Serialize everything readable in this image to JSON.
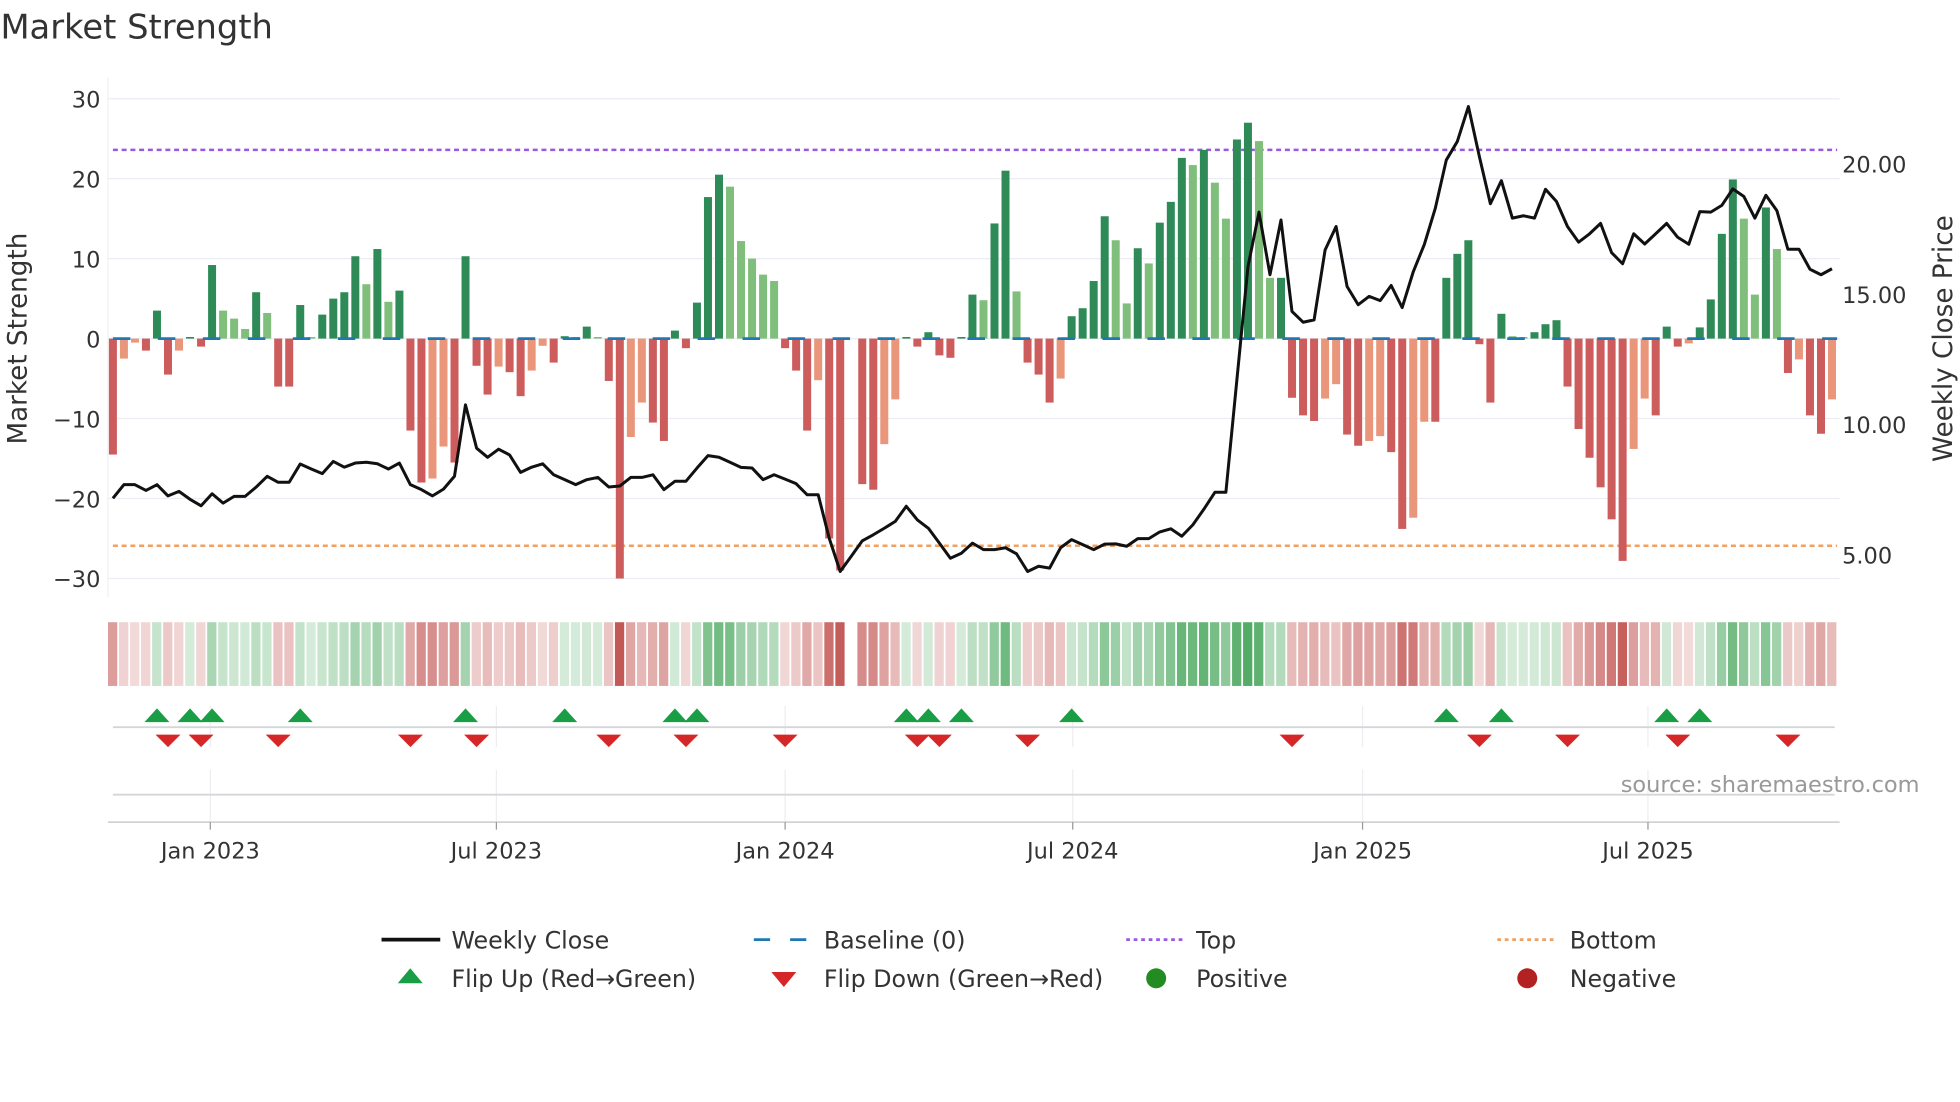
{
  "title": "Market Strength",
  "source": "source: sharemaestro.com",
  "colors": {
    "bar_pos_rising": "#2e8b57",
    "bar_pos_falling": "#7fbf7b",
    "bar_neg_falling": "#cd5c5c",
    "bar_neg_rising": "#e9967a",
    "close_line": "#111111",
    "baseline": "#1f77b4",
    "top": "#9b59e0",
    "bottom": "#f0a060",
    "flip_up": "#1a9e45",
    "flip_down": "#d62728",
    "positive": "#228b22",
    "negative": "#b22222",
    "strip_pos": "#3aa050",
    "strip_neg": "#c0504d"
  },
  "chart_data": {
    "type": "bar",
    "title": "Market Strength",
    "ylabel": "Market Strength",
    "y2label": "Weekly Close Price",
    "ylim": [
      -33,
      32
    ],
    "y2lim": [
      3.4,
      22.9
    ],
    "yticks": [
      "30",
      "20",
      "10",
      "0",
      "−10",
      "−20",
      "−30"
    ],
    "ytick_values": [
      30,
      20,
      10,
      0,
      -10,
      -20,
      -30
    ],
    "y2ticks": [
      "20.00",
      "15.00",
      "10.00",
      "5.00"
    ],
    "y2tick_values": [
      20,
      15,
      10,
      5
    ],
    "xticks": [
      {
        "label": "Jan 2023",
        "week": 8.84
      },
      {
        "label": "Jul 2023",
        "week": 34.8
      },
      {
        "label": "Jan 2024",
        "week": 61.0
      },
      {
        "label": "Jul 2024",
        "week": 87.1
      },
      {
        "label": "Jan 2025",
        "week": 113.4
      },
      {
        "label": "Jul 2025",
        "week": 139.3
      }
    ],
    "top_level": 23.6,
    "bottom_level": -25.9,
    "baseline": 0,
    "strength": [
      -14.5,
      -2.5,
      -0.5,
      -1.5,
      3.5,
      -4.5,
      -1.5,
      0.2,
      -1,
      9.2,
      3.5,
      2.5,
      1.2,
      5.8,
      3.2,
      -6,
      -6,
      4.2,
      0.2,
      3,
      5,
      5.8,
      10.3,
      6.8,
      11.2,
      4.6,
      6,
      -11.5,
      -18,
      -17.5,
      -13.5,
      -15.5,
      10.3,
      -3.4,
      -7,
      -3.5,
      -4.2,
      -7.2,
      -4,
      -0.9,
      -3,
      0.3,
      0.2,
      1.5,
      0.2,
      -5.3,
      -30,
      -12.3,
      -8,
      -10.5,
      -12.8,
      1,
      -1.2,
      4.5,
      17.7,
      20.5,
      19,
      12.2,
      10,
      8,
      7.2,
      -1.2,
      -4,
      -11.5,
      -5.2,
      -25,
      -29,
      0,
      -18.2,
      -18.9,
      -13.2,
      -7.6,
      0.2,
      -1,
      0.8,
      -2.1,
      -2.4,
      0.2,
      5.5,
      4.8,
      14.4,
      21,
      5.9,
      -3,
      -4.5,
      -8,
      -5,
      2.8,
      3.8,
      7.2,
      15.3,
      12.3,
      4.4,
      11.3,
      9.4,
      14.5,
      17.1,
      22.6,
      21.7,
      23.6,
      19.5,
      15,
      24.9,
      27,
      24.7,
      7.6,
      7.6,
      -7.4,
      -9.6,
      -10.3,
      -7.5,
      -5.7,
      -12,
      -13.4,
      -12.8,
      -12.2,
      -14.2,
      -23.8,
      -22.4,
      -10.4,
      -10.4,
      7.6,
      10.6,
      12.3,
      -0.7,
      -8,
      3.1,
      0.3,
      0.2,
      0.8,
      1.8,
      2.3,
      -6,
      -11.3,
      -14.9,
      -18.6,
      -22.6,
      -27.8,
      -13.8,
      -7.5,
      -9.6,
      1.5,
      -1,
      -0.6,
      1.4,
      4.9,
      13.1,
      19.9,
      15,
      5.5,
      16.4,
      11.2,
      -4.3,
      -2.6,
      -9.6,
      -11.9,
      -7.6
    ],
    "weekly_close": [
      7.17,
      7.69,
      7.69,
      7.47,
      7.69,
      7.26,
      7.43,
      7.13,
      6.88,
      7.34,
      6.98,
      7.24,
      7.24,
      7.6,
      8.01,
      7.78,
      7.78,
      8.48,
      8.29,
      8.11,
      8.58,
      8.36,
      8.52,
      8.55,
      8.49,
      8.29,
      8.52,
      7.69,
      7.5,
      7.26,
      7.52,
      8.01,
      10.75,
      9.09,
      8.74,
      9.05,
      8.83,
      8.16,
      8.36,
      8.49,
      8.07,
      7.88,
      7.69,
      7.88,
      7.97,
      7.6,
      7.64,
      7.97,
      7.97,
      8.07,
      7.5,
      7.82,
      7.82,
      8.33,
      8.8,
      8.74,
      8.55,
      8.35,
      8.33,
      7.88,
      8.07,
      7.9,
      7.73,
      7.3,
      7.3,
      5.64,
      4.36,
      4.94,
      5.54,
      5.77,
      6.02,
      6.28,
      6.86,
      6.34,
      6.02,
      5.45,
      4.87,
      5.06,
      5.45,
      5.2,
      5.2,
      5.27,
      5.04,
      4.36,
      4.56,
      4.49,
      5.27,
      5.58,
      5.39,
      5.2,
      5.41,
      5.42,
      5.33,
      5.62,
      5.62,
      5.88,
      6.0,
      5.71,
      6.15,
      6.75,
      7.4,
      7.4,
      11.71,
      16.06,
      18.14,
      15.74,
      17.84,
      14.33,
      13.92,
      14.01,
      16.69,
      17.59,
      15.29,
      14.59,
      14.91,
      14.75,
      15.33,
      14.48,
      15.86,
      16.9,
      18.29,
      20.14,
      20.85,
      22.19,
      20.27,
      18.46,
      19.35,
      17.91,
      18.0,
      17.91,
      19.02,
      18.55,
      17.59,
      16.99,
      17.31,
      17.71,
      16.59,
      16.16,
      17.31,
      16.92,
      17.31,
      17.71,
      17.18,
      16.91,
      18.16,
      18.14,
      18.4,
      19.03,
      18.74,
      17.91,
      18.79,
      18.2,
      16.72,
      16.72,
      15.95,
      15.74,
      15.97
    ],
    "legend": [
      {
        "label": "Weekly Close",
        "kind": "line"
      },
      {
        "label": "Baseline (0)",
        "kind": "dash"
      },
      {
        "label": "Top",
        "kind": "dot-top"
      },
      {
        "label": "Bottom",
        "kind": "dot-bottom"
      },
      {
        "label": "Flip Up (Red→Green)",
        "kind": "up"
      },
      {
        "label": "Flip Down (Green→Red)",
        "kind": "down"
      },
      {
        "label": "Positive",
        "kind": "pos"
      },
      {
        "label": "Negative",
        "kind": "neg"
      }
    ],
    "legend_placement": "bottom"
  }
}
